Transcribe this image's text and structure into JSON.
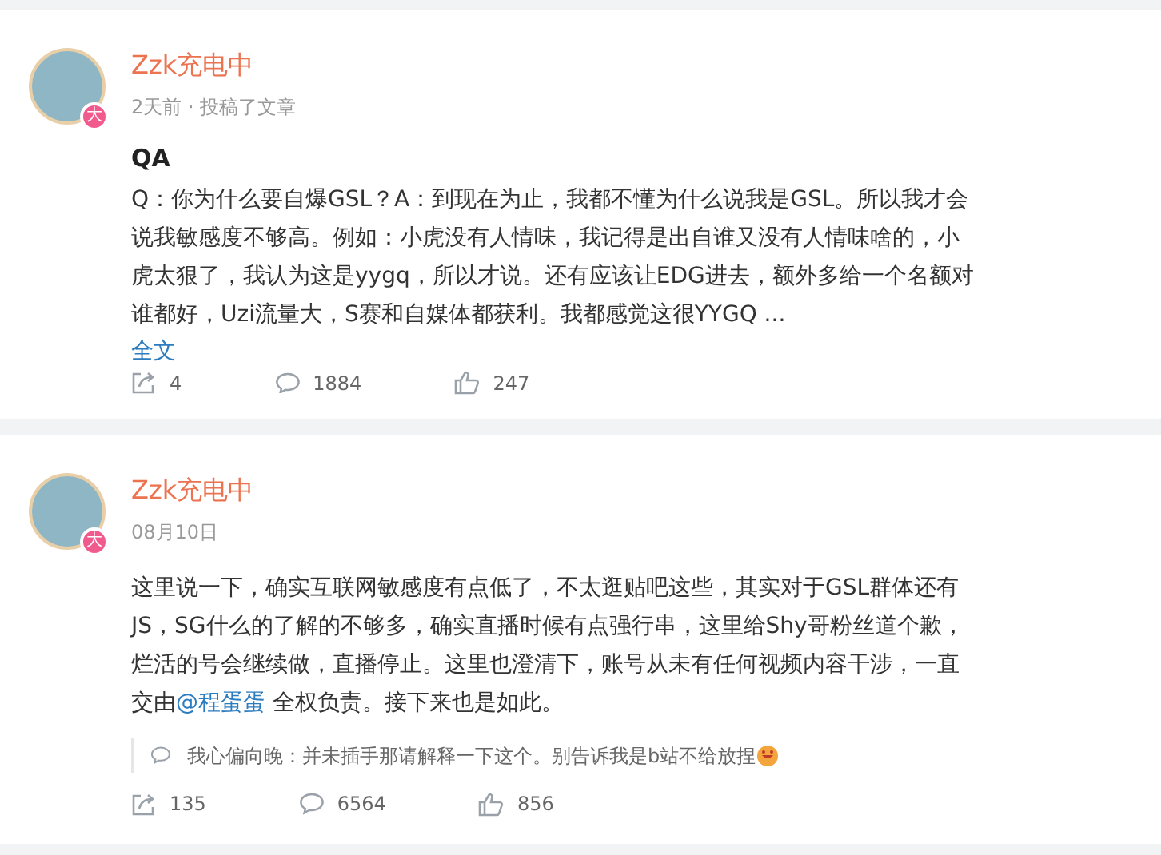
{
  "posts": [
    {
      "author": "Zzk充电中",
      "badge": "大",
      "meta": "2天前 · 投稿了文章",
      "title": "QA",
      "body": [
        {
          "kind": "text",
          "text": "Q：你为什么要自爆GSL？A：到现在为止，我都不懂为什么说我是GSL。所以我才会说我敏感度不够高。例如：小虎没有人情味，我记得是出自谁又没有人情味啥的，小虎太狠了，我认为这是yygq，所以才说。还有应该让EDG进去，额外多给一个名额对谁都好，Uzi流量大，S赛和自媒体都获利。我都感觉这很YYGQ ..."
        }
      ],
      "more": "全文",
      "stats": {
        "shares": "4",
        "comments": "1884",
        "likes": "247"
      }
    },
    {
      "author": "Zzk充电中",
      "badge": "大",
      "meta": "08月10日",
      "body": [
        {
          "kind": "text",
          "text": "这里说一下，确实互联网敏感度有点低了，不太逛贴吧这些，其实对于GSL群体还有JS，SG什么的了解的不够多，确实直播时候有点强行串，这里给Shy哥粉丝道个歉，烂活的号会继续做，直播停止。这里也澄清下，账号从未有任何视频内容干涉，一直交由"
        },
        {
          "kind": "mention",
          "text": "@程蛋蛋"
        },
        {
          "kind": "text",
          "text": " 全权负责。接下来也是如此。"
        }
      ],
      "reply": {
        "user": "我心偏向晚：",
        "text": "并未插手那请解释一下这个。别告诉我是b站不给放捏"
      },
      "stats": {
        "shares": "135",
        "comments": "6564",
        "likes": "856"
      }
    }
  ]
}
